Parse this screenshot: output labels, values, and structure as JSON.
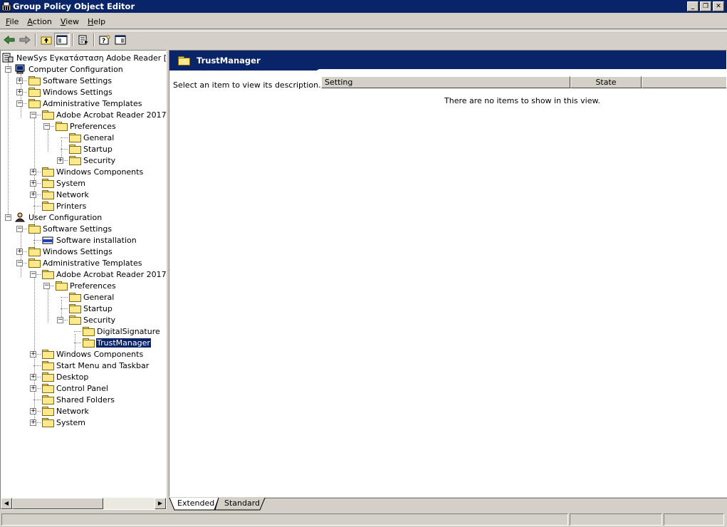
{
  "window": {
    "title": "Group Policy Object Editor"
  },
  "menu": {
    "file": "File",
    "file_rest": "ile",
    "action": "Action",
    "action_rest": "ction",
    "view": "View",
    "view_rest": "iew",
    "help": "Help",
    "help_rest": "elp"
  },
  "menu_labels": {
    "file_u": "F",
    "action_u": "A",
    "view_u": "V",
    "help_u": "H"
  },
  "tree": {
    "root": "NewSys Εγκατάσταση Adobe Reader [atlas.",
    "items": [
      "Computer Configuration",
      "Software Settings",
      "Windows Settings",
      "Administrative Templates",
      "Adobe Acrobat Reader 2017",
      "Preferences",
      "General",
      "Startup",
      "Security",
      "Windows Components",
      "System",
      "Network",
      "Printers",
      "User Configuration",
      "Software Settings",
      "Software installation",
      "Windows Settings",
      "Administrative Templates",
      "Adobe Acrobat Reader 2017",
      "Preferences",
      "General",
      "Startup",
      "Security",
      "DigitalSignature",
      "TrustManager",
      "Windows Components",
      "Start Menu and Taskbar",
      "Desktop",
      "Control Panel",
      "Shared Folders",
      "Network",
      "System"
    ]
  },
  "details": {
    "header": "TrustManager",
    "description": "Select an item to view its description.",
    "columns": [
      "Setting",
      "State"
    ],
    "empty_message": "There are no items to show in this view."
  },
  "tabs": [
    "Extended",
    "Standard"
  ]
}
